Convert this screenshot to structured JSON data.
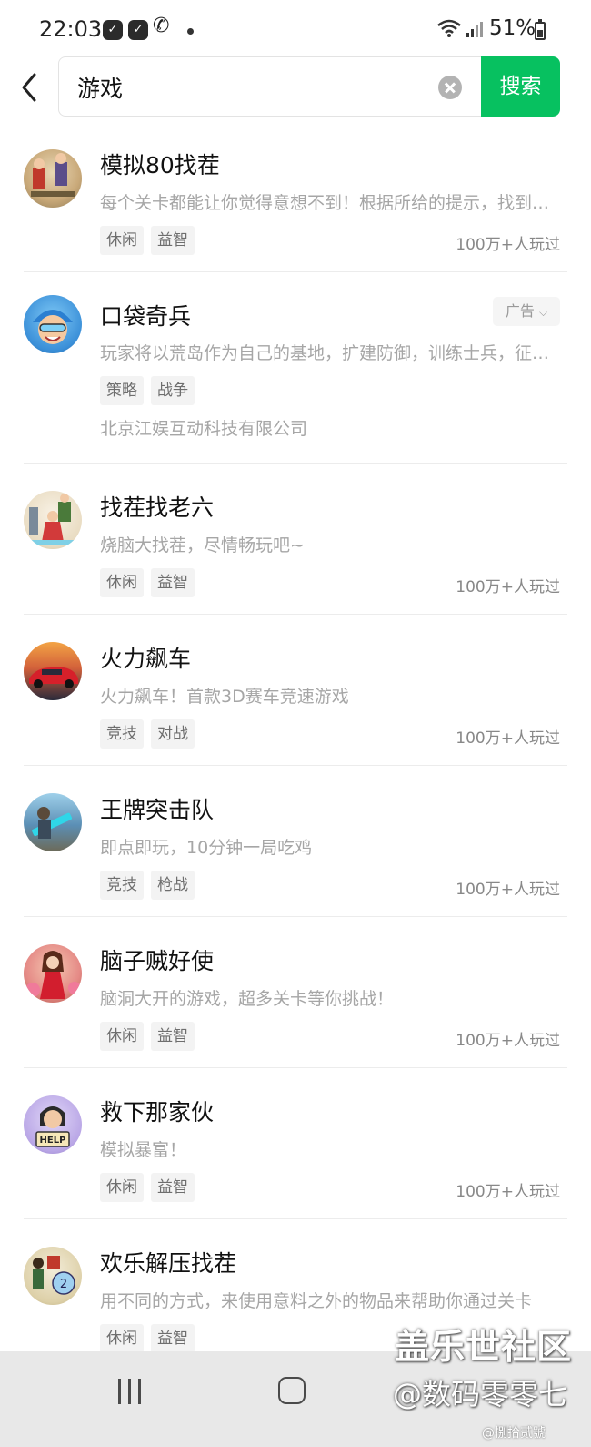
{
  "status_bar": {
    "time": "22:03",
    "battery": "51%"
  },
  "search": {
    "value": "游戏",
    "button_label": "搜索"
  },
  "games": [
    {
      "title": "模拟80找茬",
      "desc": "每个关卡都能让你觉得意想不到！根据所给的提示，找到场景中的不同之处",
      "tags": [
        "休闲",
        "益智"
      ],
      "players": "100万+人玩过"
    },
    {
      "title": "口袋奇兵",
      "desc": "玩家将以荒岛作为自己的基地，扩建防御，训练士兵，征服世界",
      "tags": [
        "策略",
        "战争"
      ],
      "company": "北京江娱互动科技有限公司",
      "ad_label": "广告"
    },
    {
      "title": "找茬找老六",
      "desc": "烧脑大找茬，尽情畅玩吧~",
      "tags": [
        "休闲",
        "益智"
      ],
      "players": "100万+人玩过"
    },
    {
      "title": "火力飙车",
      "desc": "火力飙车！首款3D赛车竞速游戏",
      "tags": [
        "竞技",
        "对战"
      ],
      "players": "100万+人玩过"
    },
    {
      "title": "王牌突击队",
      "desc": "即点即玩，10分钟一局吃鸡",
      "tags": [
        "竞技",
        "枪战"
      ],
      "players": "100万+人玩过"
    },
    {
      "title": "脑子贼好使",
      "desc": "脑洞大开的游戏，超多关卡等你挑战！",
      "tags": [
        "休闲",
        "益智"
      ],
      "players": "100万+人玩过"
    },
    {
      "title": "救下那家伙",
      "desc": "模拟暴富！",
      "tags": [
        "休闲",
        "益智"
      ],
      "players": "100万+人玩过",
      "avatar_text": "HELP"
    },
    {
      "title": "欢乐解压找茬",
      "desc": "用不同的方式，来使用意料之外的物品来帮助你通过关卡",
      "tags": [
        "休闲",
        "益智"
      ]
    }
  ],
  "watermark": {
    "line1": "盖乐世社区",
    "line2": "@数码零零七",
    "line3": "@捌拾贰號"
  },
  "colors": {
    "accent": "#07c160",
    "tag_bg": "#f3f3f3",
    "desc_text": "#a6a6a6"
  },
  "icons": [
    "back-arrow-icon",
    "clear-icon",
    "wifi-icon",
    "signal-icon",
    "battery-icon",
    "nav-recent-icon",
    "nav-home-icon"
  ]
}
